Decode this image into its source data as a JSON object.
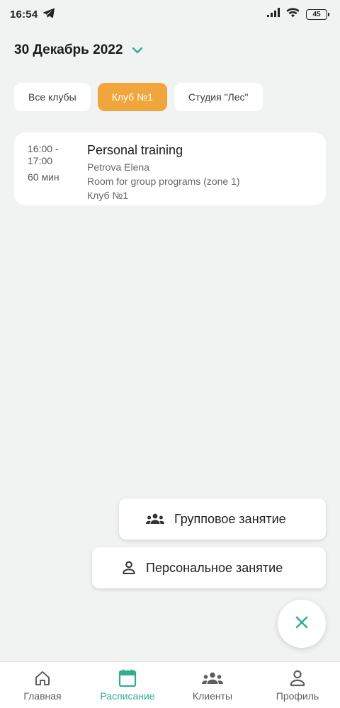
{
  "status_bar": {
    "time": "16:54",
    "battery": "45"
  },
  "header": {
    "date": "30 Декабрь 2022"
  },
  "clubs": [
    {
      "label": "Все клубы",
      "active": false
    },
    {
      "label": "Клуб №1",
      "active": true
    },
    {
      "label": "Студия \"Лес\"",
      "active": false
    }
  ],
  "events": [
    {
      "time_range": "16:00 - 17:00",
      "duration": "60 мин",
      "title": "Personal training",
      "trainer": "Petrova Elena",
      "room": "Room for group programs (zone 1)",
      "club": "Клуб №1"
    }
  ],
  "fab_menu": {
    "group_label": "Групповое занятие",
    "personal_label": "Персональное занятие"
  },
  "bottom_nav": [
    {
      "label": "Главная",
      "icon": "home-icon",
      "active": false
    },
    {
      "label": "Расписание",
      "icon": "calendar-icon",
      "active": true
    },
    {
      "label": "Клиенты",
      "icon": "clients-icon",
      "active": false
    },
    {
      "label": "Профиль",
      "icon": "profile-icon",
      "active": false
    }
  ],
  "colors": {
    "accent": "#2fae8f",
    "active_chip": "#f0a63c",
    "background": "#f1f2f2"
  }
}
